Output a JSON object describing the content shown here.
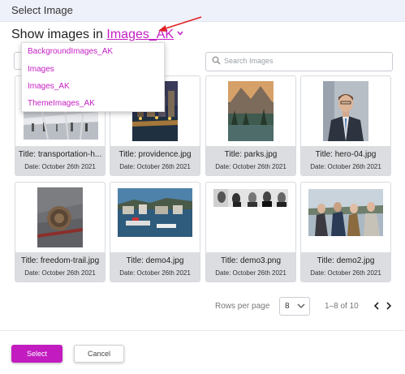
{
  "window": {
    "title": "Select Image"
  },
  "header": {
    "prefix": "Show images in ",
    "library": "Images_AK"
  },
  "search": {
    "placeholder": "Search Images"
  },
  "library_menu": {
    "items": [
      "BackgroundImages_AK",
      "Images",
      "Images_AK",
      "ThemeImages_AK"
    ]
  },
  "images": [
    {
      "title": "Title: transportation-h...",
      "date": "Date: October 26th 2021"
    },
    {
      "title": "Title: providence.jpg",
      "date": "Date: October 26th 2021"
    },
    {
      "title": "Title: parks.jpg",
      "date": "Date: October 26th 2021"
    },
    {
      "title": "Title: hero-04.jpg",
      "date": "Date: October 26th 2021"
    },
    {
      "title": "Title: freedom-trail.jpg",
      "date": "Date: October 26th 2021"
    },
    {
      "title": "Title: demo4.jpg",
      "date": "Date: October 26th 2021"
    },
    {
      "title": "Title: demo3.png",
      "date": "Date: October 26th 2021"
    },
    {
      "title": "Title: demo2.jpg",
      "date": "Date: October 26th 2021"
    }
  ],
  "pagination": {
    "rows_label": "Rows per page",
    "rows_value": "8",
    "range": "1–8 of 10"
  },
  "footer": {
    "select_label": "Select",
    "cancel_label": "Cancel"
  },
  "colors": {
    "accent": "#c21cc0",
    "annotation_arrow": "#e02020"
  }
}
